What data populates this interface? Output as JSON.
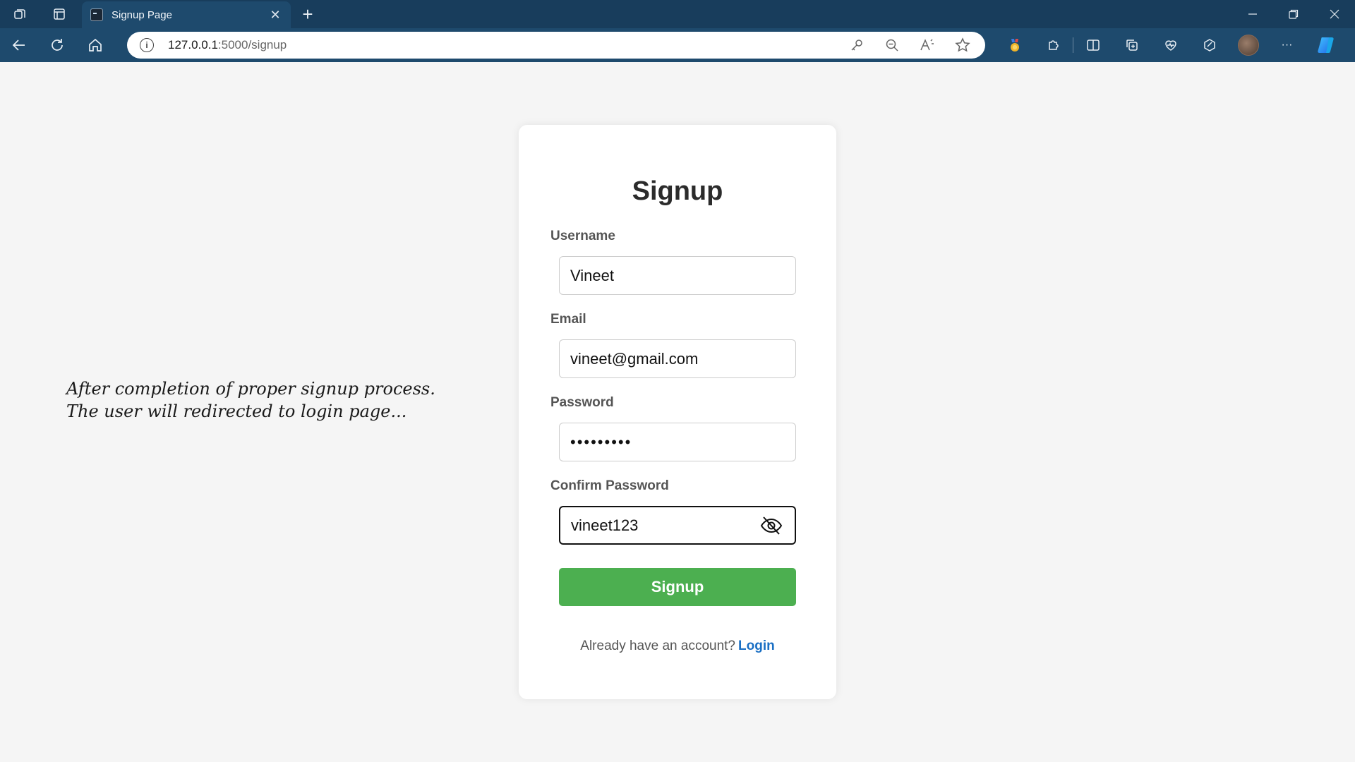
{
  "browser": {
    "tab_title": "Signup Page",
    "tab_close": "✕",
    "new_tab": "+",
    "url_host": "127.0.0.1",
    "url_rest": ":5000/signup",
    "info_symbol": "i",
    "more_symbol": "···"
  },
  "note": {
    "line1": "After completion of proper signup process.",
    "line2": "The user will redirected to login page..."
  },
  "form": {
    "title": "Signup",
    "username_label": "Username",
    "username_value": "Vineet",
    "email_label": "Email",
    "email_value": "vineet@gmail.com",
    "password_label": "Password",
    "password_masked": "•••••••••",
    "confirm_label": "Confirm Password",
    "confirm_value": "vineet123",
    "submit_label": "Signup",
    "footer_text": "Already have an account?",
    "login_link": "Login"
  },
  "colors": {
    "chrome_dark": "#183d5c",
    "chrome": "#1e4a6d",
    "button_green": "#4caf50",
    "link_blue": "#1a6fc4"
  }
}
